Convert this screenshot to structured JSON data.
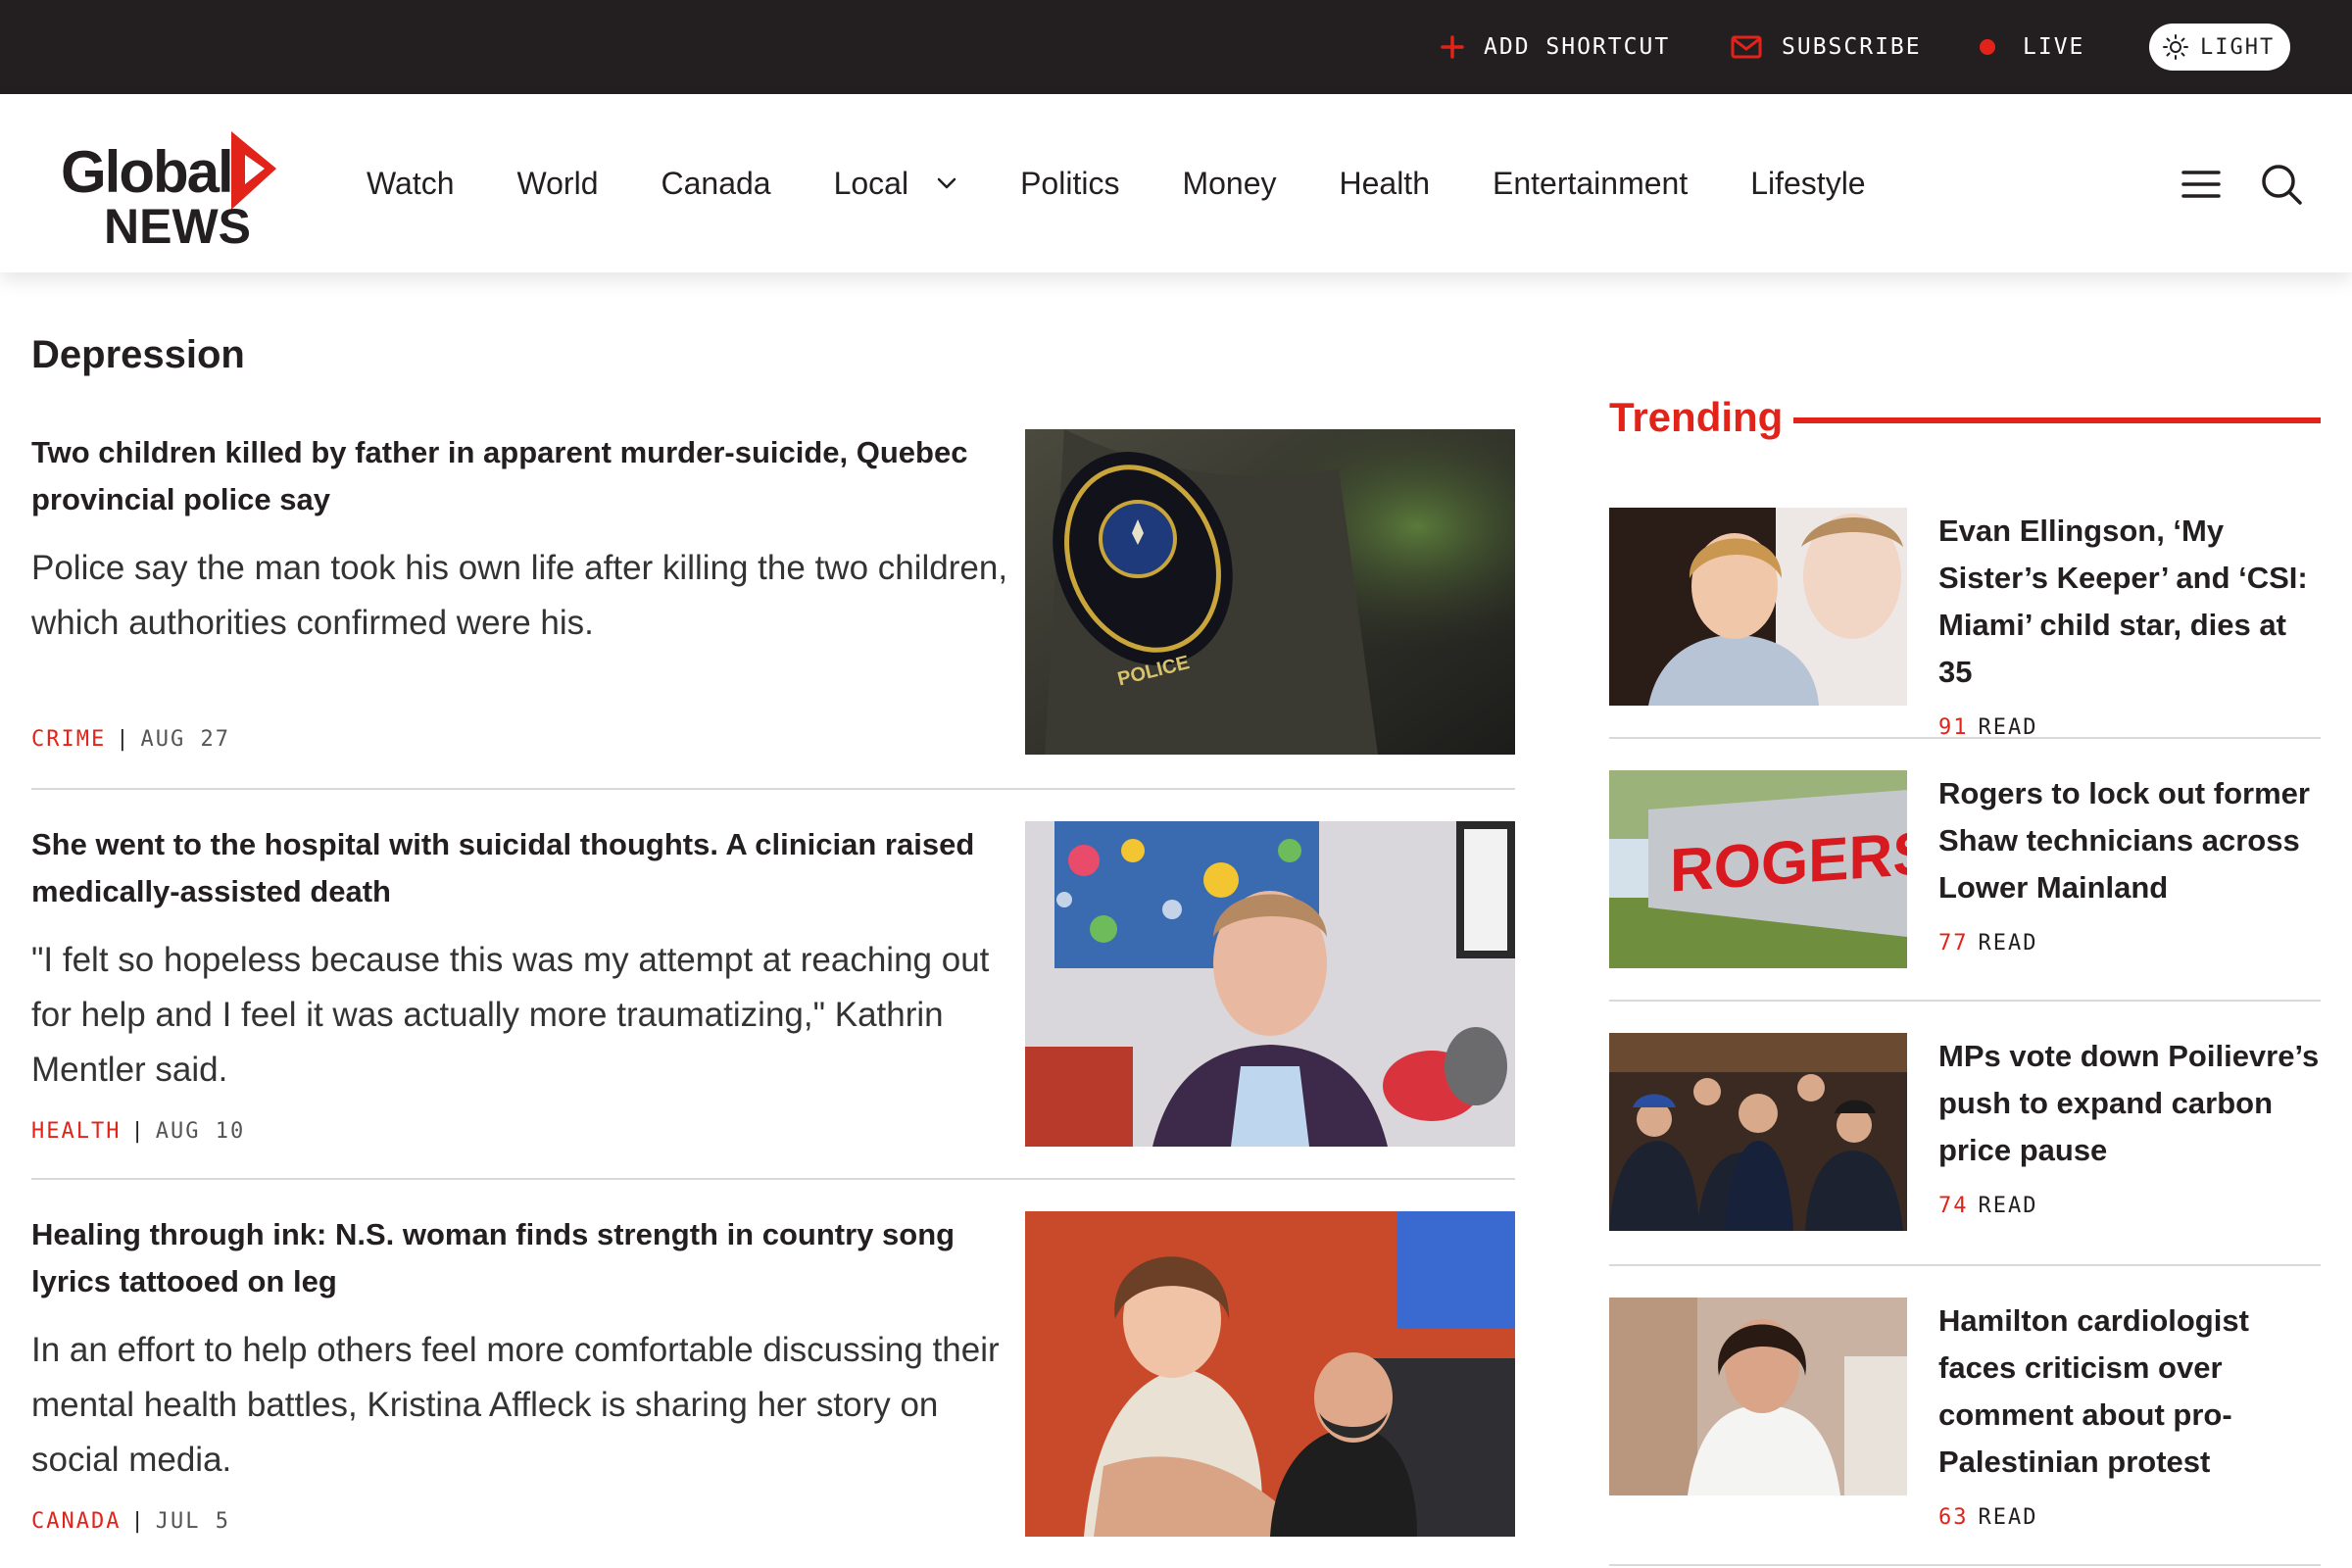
{
  "topbar": {
    "shortcut_label": "ADD SHORTCUT",
    "subscribe_label": "SUBSCRIBE",
    "live_label": "LIVE",
    "theme_label": "LIGHT",
    "icons": [
      "plus-icon",
      "mail-icon",
      "live-dot-icon",
      "sun-icon"
    ],
    "colors": {
      "bar": "#231f20",
      "accent": "#e2231a"
    }
  },
  "header": {
    "logo_line1": "Global",
    "logo_line2": "NEWS",
    "nav": [
      "Watch",
      "World",
      "Canada",
      "Local",
      "Politics",
      "Money",
      "Health",
      "Entertainment",
      "Lifestyle"
    ],
    "icons": [
      "menu-icon",
      "search-icon",
      "chevron-down-icon"
    ]
  },
  "page": {
    "title": "Depression"
  },
  "stories": [
    {
      "headline": "Two children killed by father in apparent murder-suicide, Quebec provincial police say",
      "summary": "Police say the man took his own life after killing the two children, which authorities confirmed were his.",
      "category": "CRIME",
      "date": "AUG 27"
    },
    {
      "headline": "She went to the hospital with suicidal thoughts. A clinician raised medically-assisted death",
      "summary": "\"I felt so hopeless because this was my attempt at reaching out for help and I feel it was actually more traumatizing,\" Kathrin Mentler said.",
      "category": "HEALTH",
      "date": "AUG 10"
    },
    {
      "headline": "Healing through ink: N.S. woman finds strength in country song lyrics tattooed on leg",
      "summary": "In an effort to help others feel more comfortable discussing their mental health battles, Kristina Affleck is sharing her story on social media.",
      "category": "CANADA",
      "date": "JUL 5"
    }
  ],
  "trending": {
    "title": "Trending",
    "read_label": "READ",
    "items": [
      {
        "headline": "Evan Ellingson, ‘My Sister’s Keeper’ and ‘CSI: Miami’ child star, dies at 35",
        "count": "91"
      },
      {
        "headline": "Rogers to lock out former Shaw technicians across Lower Mainland",
        "count": "77"
      },
      {
        "headline": "MPs vote down Poilievre’s push to expand carbon price pause",
        "count": "74"
      },
      {
        "headline": "Hamilton cardiologist faces criticism over comment about pro-Palestinian protest",
        "count": "63"
      }
    ],
    "image_texts": {
      "rogers_sign": "ROGERS",
      "police_patch": "POLICE"
    }
  }
}
